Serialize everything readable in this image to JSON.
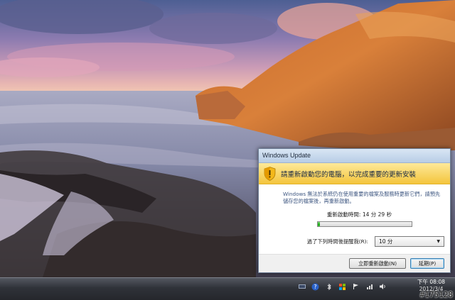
{
  "dialog": {
    "title": "Windows Update",
    "heading": "請重新啟動您的電腦，以完成重要的更新安裝",
    "message": "Windows 無法於系統仍在使用重要的檔案及服務時更新它們，請預先儲存您的檔案後，再重新啟動。",
    "countdown_label": "重新啟動時間: 14 分 29 秒",
    "progress_fraction": 0.02,
    "remind_label": "過了下列時間後提醒我(R):",
    "remind_selected": "10 分",
    "restart_button": "立即重新啟動(N)",
    "postpone_button": "延期(P)",
    "shield_icon": "shield-warning-icon"
  },
  "taskbar": {
    "tray_icons": [
      "network-icon",
      "help-icon",
      "bluetooth-icon",
      "windows-update-icon",
      "signal-icon",
      "flag-icon",
      "volume-icon"
    ],
    "time": "下午 08:08",
    "date": "2012/3/4"
  },
  "watermark": "#175128"
}
